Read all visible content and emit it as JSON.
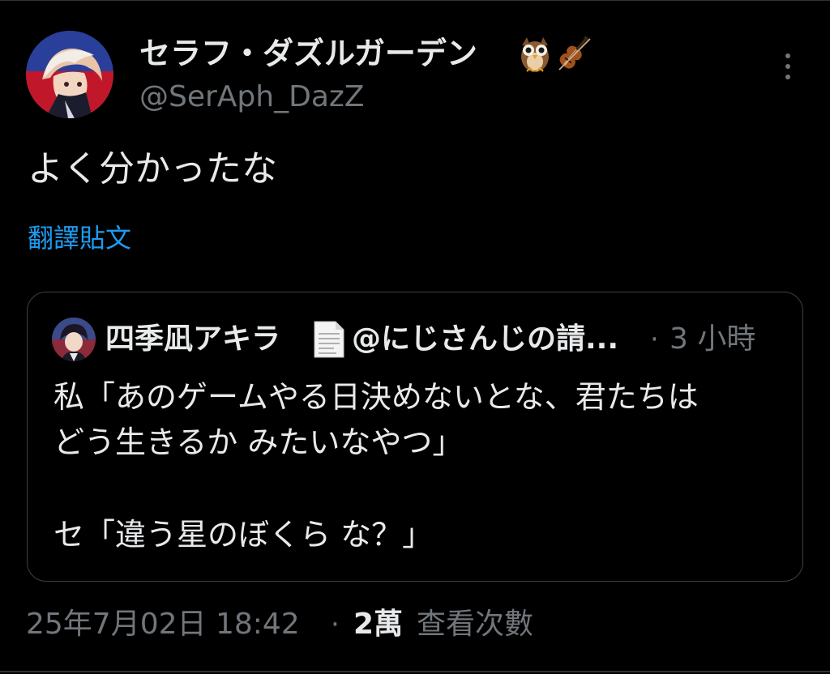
{
  "author": {
    "display_name": "セラフ・ダズルガーデン",
    "name_emoji": [
      "owl-icon",
      "violin-icon"
    ],
    "handle": "@SerAph_DazZ"
  },
  "tweet": {
    "text": "よく分かったな",
    "translate_label": "翻譯貼文"
  },
  "quote": {
    "author_name": "四季凪アキラ",
    "author_emoji": "document-icon",
    "author_handle": "@にじさんじの請...",
    "separator": "·",
    "time": "3 小時",
    "lines": [
      "私「あのゲームやる日決めないとな、君たちは",
      "どう生きるか みたいなやつ」",
      "",
      "セ「違う星のぼくら な？」"
    ]
  },
  "footer": {
    "timestamp": "25年7月02日 18:42",
    "separator": "·",
    "views_count": "2萬",
    "views_label": "查看次數"
  },
  "colors": {
    "background": "#000000",
    "primary_text": "#e7e9ea",
    "secondary_text": "#71767b",
    "link": "#1d9bf0",
    "border": "#3e4144"
  }
}
